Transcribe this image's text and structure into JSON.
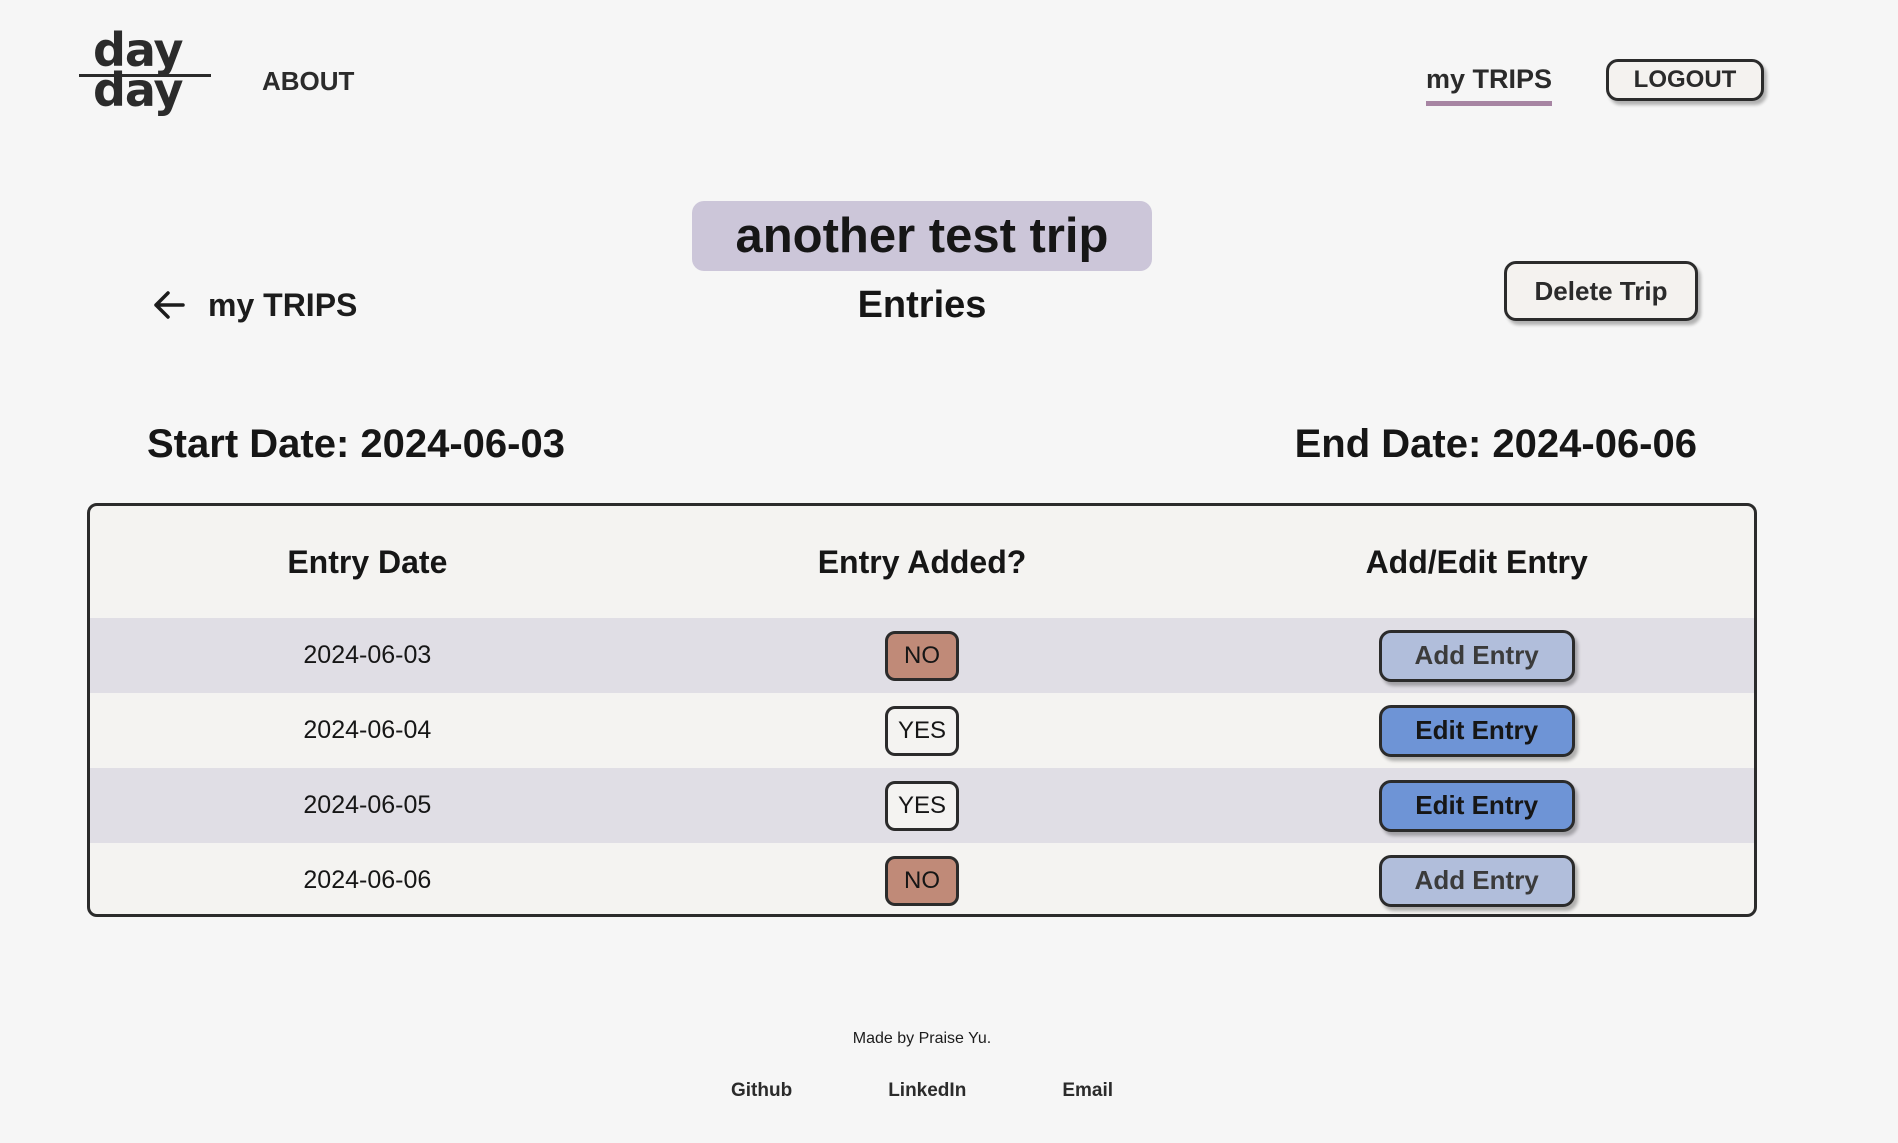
{
  "header": {
    "logo_top": "day",
    "logo_bottom": "day",
    "about_label": "ABOUT",
    "my_trips_label": "my TRIPS",
    "logout_label": "LOGOUT"
  },
  "trip": {
    "title": "another test trip",
    "entries_heading": "Entries",
    "back_label": "my TRIPS",
    "delete_label": "Delete Trip",
    "start_date": "Start Date: 2024-06-03",
    "end_date": "End Date: 2024-06-06"
  },
  "table": {
    "headers": [
      "Entry Date",
      "Entry Added?",
      "Add/Edit Entry"
    ],
    "rows": [
      {
        "date": "2024-06-03",
        "added": "NO",
        "action": "Add Entry"
      },
      {
        "date": "2024-06-04",
        "added": "YES",
        "action": "Edit Entry"
      },
      {
        "date": "2024-06-05",
        "added": "YES",
        "action": "Edit Entry"
      },
      {
        "date": "2024-06-06",
        "added": "NO",
        "action": "Add Entry"
      }
    ]
  },
  "footer": {
    "credit": "Made by Praise Yu.",
    "links": [
      "Github",
      "LinkedIn",
      "Email"
    ]
  },
  "colors": {
    "background": "#f6f6f6",
    "title_highlight": "#ccc6d9",
    "nav_underline": "#a785a3",
    "row_alt": "#e0dee5",
    "no_badge": "#c08a78",
    "add_button": "#b1bedb",
    "edit_button": "#6e94d6"
  },
  "icons": {
    "back": "arrow-left-icon"
  }
}
